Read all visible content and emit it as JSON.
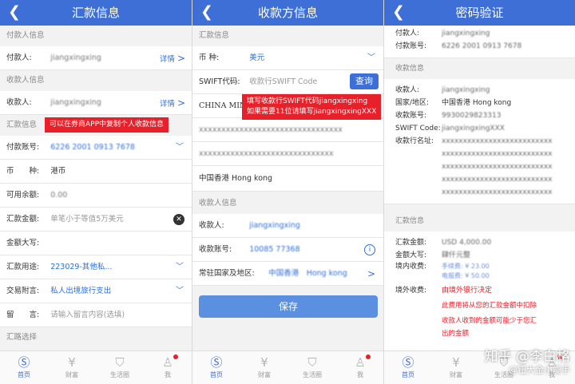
{
  "panel1": {
    "title": "汇款信息",
    "sections": {
      "payer": "付款人信息",
      "payee": "收款人信息",
      "remit": "汇款信息",
      "route": "汇路选择"
    },
    "payer_label": "付款人:",
    "payer_value": "jiangxingxing",
    "payee_label": "收款人:",
    "payee_value": "jiangxingxing",
    "detail_link": "详情",
    "tip": "可以在券商APP中复制个人收款信息",
    "rows": {
      "account_label": "付款账号:",
      "account_value": "6226 2001 0913 7678",
      "currency_label": "币　　种:",
      "currency_value": "港币",
      "balance_label": "可用余额:",
      "balance_value": "0.00",
      "amount_label": "汇款金额:",
      "amount_placeholder": "单笔小于等值5万美元",
      "upper_label": "金额大写:",
      "purpose_label": "汇款用途:",
      "purpose_value": "223029-其他私...",
      "note_label": "交易附言:",
      "note_value": "私人出境旅行支出",
      "message_label": "留　　言:",
      "message_placeholder": "请输入留言内容(选填)"
    }
  },
  "panel2": {
    "title": "收款方信息",
    "sections": {
      "remit": "汇款信息",
      "payee": "收款人信息"
    },
    "currency_label": "币 种:",
    "currency_value": "美元",
    "swift_label": "SWIFT代码:",
    "swift_placeholder": "收款行SWIFT Code",
    "query_btn": "查询",
    "bank_name": "CHINA MINS",
    "blur1": "xxxxxxxxxxxxxxxxxxxxxxxxxxxxxxxx",
    "blur2": "xxxxxxxxxxxxxxxxxxxxxxxxxxxxxx",
    "country": "中国香港 Hong kong",
    "tip_line1": "填写收款行SWIFT代码jiangxingxing",
    "tip_line2": "如果需要11位请填写jiangxingxingXXX",
    "payee_label": "收款人:",
    "payee_value": "jiangxingxing",
    "acct_label": "收款账号:",
    "acct_value": "10085 77368",
    "region_label": "常驻国家及地区:",
    "region_value": "中国香港　Hong kong",
    "save_btn": "保存"
  },
  "panel3": {
    "title": "密码验证",
    "top": {
      "payer_k": "付款人:",
      "payer_v": "jiangxingxing",
      "acct_k": "付款账号:",
      "acct_v": "6226 2001 0913 7678"
    },
    "payee_sec": "收款信息",
    "payee": {
      "name_k": "收款人:",
      "name_v": "jiangxingxing",
      "region_k": "国家/地区:",
      "region_v": "中国香港 Hong kong",
      "acct_k": "收款账号:",
      "acct_v": "9930029823313",
      "swift_k": "SWIFT Code:",
      "swift_v": "jiangxingxingXXX",
      "bank_k": "收款行名址:",
      "bank_v1": "xxxxxxxxxxxxxxxxxxxxxxxxxx",
      "bank_v2": "xxxxxxxxxxxxxxxxxxxxxxxxxx",
      "bank_v3": "xxxxxxxxxxxxxxxxxxxxxxxxxx",
      "bank_v4": "xxxxxxxxxxxxxxxxxxxxxxxxxx",
      "bank_v5": "xxxxxxxxxxxxxxxxxxxxxxxxxx"
    },
    "remit_sec": "汇款信息",
    "remit": {
      "amount_k": "汇款金额:",
      "amount_v": "USD 4,000.00",
      "upper_k": "金额大写:",
      "upper_v": "肆仟元整",
      "fee_k": "境内收费:",
      "fee_a": "手续费: ¥ 23.00",
      "fee_b": "电报费: ¥ 50.00",
      "abroad_k": "境外收费:",
      "abroad_v": "由境外银行决定",
      "note1": "此费用将从您的汇款金额中扣除",
      "note2": "收款人收到的金额可能少于您汇",
      "note3": "出的金额"
    },
    "watermark_1": "知乎 @李白格",
    "watermark_2": "@钮大金小能手"
  },
  "tabs": [
    {
      "label": "首页",
      "icon": "home-s-icon"
    },
    {
      "label": "财富",
      "icon": "yen-icon"
    },
    {
      "label": "生活圈",
      "icon": "bag-icon"
    },
    {
      "label": "我",
      "icon": "person-icon"
    }
  ],
  "colors": {
    "nav": "#3d6fd6",
    "accent": "#2f6fd8",
    "alert": "#e8202a"
  }
}
